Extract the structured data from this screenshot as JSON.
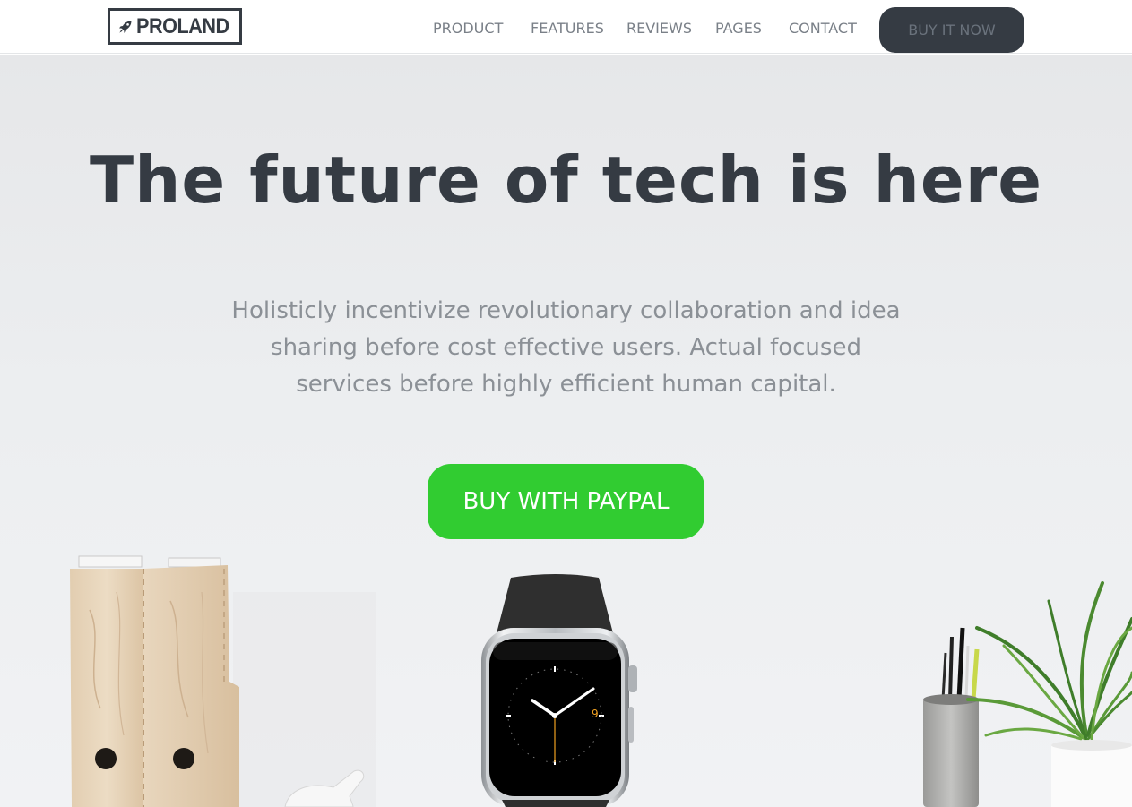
{
  "header": {
    "logo_text": "PROLAND",
    "logo_icon": "rocket-icon",
    "nav": [
      {
        "label": "PRODUCT"
      },
      {
        "label": "FEATURES"
      },
      {
        "label": "REVIEWS"
      },
      {
        "label": "PAGES"
      },
      {
        "label": "CONTACT"
      }
    ],
    "cta_label": "BUY IT NOW"
  },
  "hero": {
    "headline": "The future of tech is here",
    "subtext": "Holisticly incentivize revolutionary collaboration and idea sharing before cost effective users. Actual focused services before highly efficient human capital.",
    "button_label": "BUY WITH PAYPAL",
    "watch_dial_number": "9"
  },
  "colors": {
    "primary_dark": "#353b43",
    "accent_green": "#31cc31",
    "nav_text": "#7a8088",
    "body_text": "#8b9096"
  }
}
